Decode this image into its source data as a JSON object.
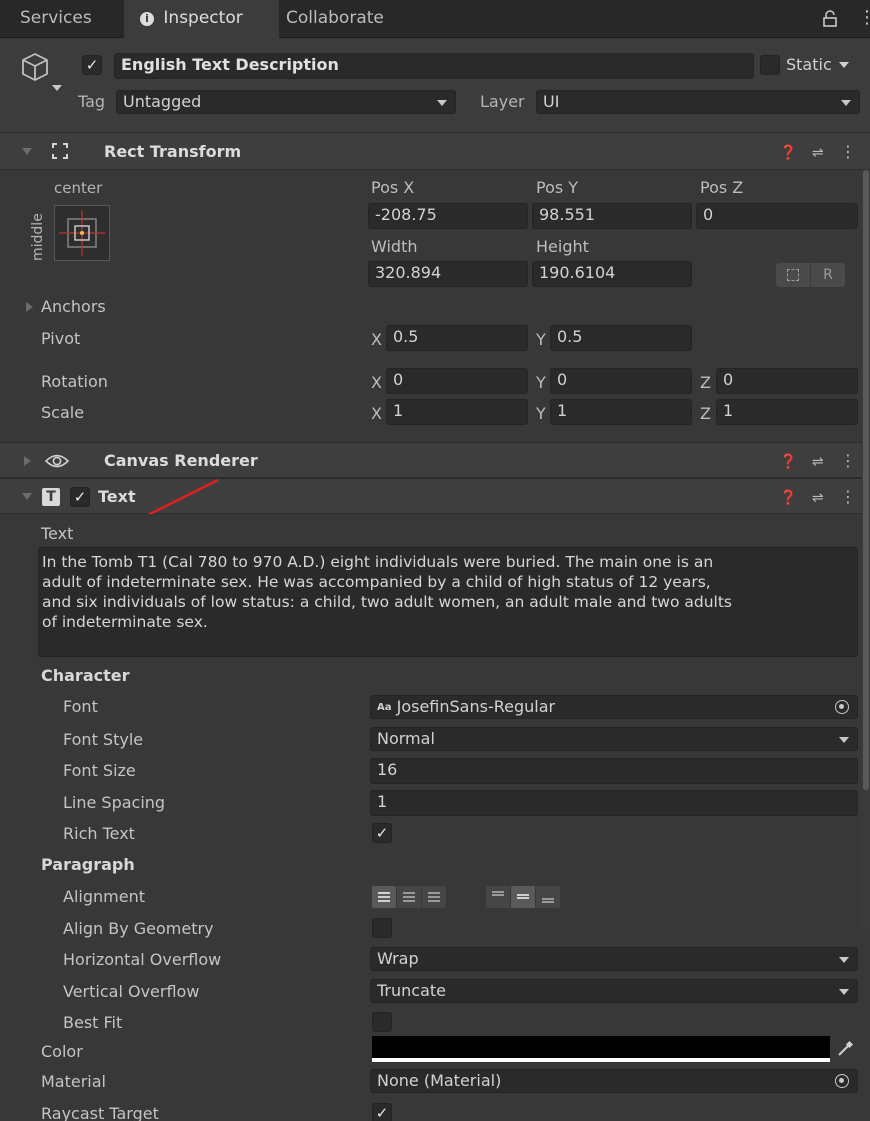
{
  "tabs": [
    {
      "label": "Services"
    },
    {
      "label": "Inspector"
    },
    {
      "label": "Collaborate"
    }
  ],
  "object": {
    "name": "English Text Description",
    "static_label": "Static",
    "tag_label": "Tag",
    "tag_value": "Untagged",
    "layer_label": "Layer",
    "layer_value": "UI"
  },
  "rect_transform": {
    "title": "Rect Transform",
    "anchor_h": "center",
    "anchor_v": "middle",
    "pos_x_label": "Pos X",
    "pos_y_label": "Pos Y",
    "pos_z_label": "Pos Z",
    "pos_x": "-208.75",
    "pos_y": "98.551",
    "pos_z": "0",
    "width_label": "Width",
    "height_label": "Height",
    "width": "320.894",
    "height": "190.6104",
    "r_label": "R",
    "anchors_label": "Anchors",
    "pivot_label": "Pivot",
    "pivot_x": "0.5",
    "pivot_y": "0.5",
    "rotation_label": "Rotation",
    "rot_x": "0",
    "rot_y": "0",
    "rot_z": "0",
    "scale_label": "Scale",
    "scale_x": "1",
    "scale_y": "1",
    "scale_z": "1",
    "x": "X",
    "y": "Y",
    "z": "Z"
  },
  "canvas_renderer": {
    "title": "Canvas Renderer"
  },
  "text_component": {
    "title": "Text",
    "text_label": "Text",
    "text_lines": [
      "In the Tomb T1 (Cal 780 to 970 A.D.) eight individuals were buried. The main one is an",
      "adult of indeterminate sex. He was accompanied by a child of high status of 12 years,",
      "and six individuals of low status: a child, two adult women, an adult male and two adults",
      "of indeterminate sex."
    ],
    "character_label": "Character",
    "font_label": "Font",
    "font_value": "JosefinSans-Regular",
    "font_icon_text": "Aa",
    "font_style_label": "Font Style",
    "font_style_value": "Normal",
    "font_size_label": "Font Size",
    "font_size_value": "16",
    "line_spacing_label": "Line Spacing",
    "line_spacing_value": "1",
    "rich_text_label": "Rich Text",
    "rich_text": true,
    "paragraph_label": "Paragraph",
    "alignment_label": "Alignment",
    "align_by_geometry_label": "Align By Geometry",
    "align_by_geometry": false,
    "horizontal_overflow_label": "Horizontal Overflow",
    "horizontal_overflow_value": "Wrap",
    "vertical_overflow_label": "Vertical Overflow",
    "vertical_overflow_value": "Truncate",
    "best_fit_label": "Best Fit",
    "best_fit": false,
    "color_label": "Color",
    "color_value": "#000000",
    "material_label": "Material",
    "material_value": "None (Material)",
    "raycast_label": "Raycast Target",
    "raycast": true
  },
  "colors": {
    "panel_bg": "#383838",
    "field_bg": "#2a2a2a",
    "header_bg": "#3e3e3e",
    "annotation_arrow": "#e02020"
  },
  "icons": [
    "gameobject-cube-icon",
    "info-icon",
    "lock-icon",
    "more-vert-icon",
    "rect-transform-icon",
    "eye-icon",
    "text-component-icon",
    "help-icon",
    "preset-icon",
    "color-picker-icon",
    "object-picker-icon"
  ]
}
